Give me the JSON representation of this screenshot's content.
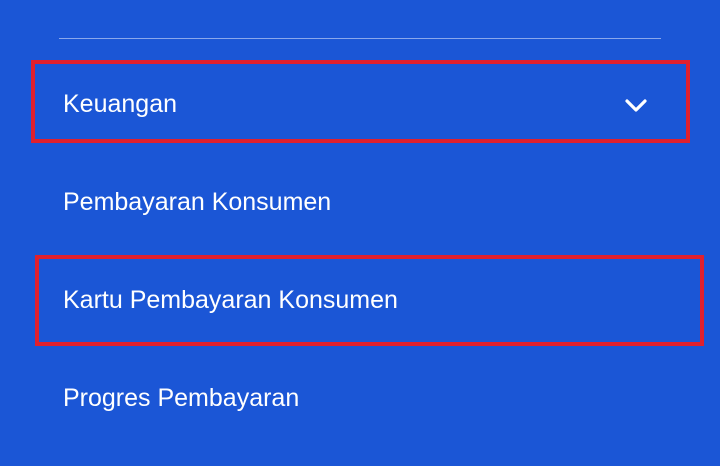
{
  "menu": {
    "items": [
      {
        "label": "Keuangan",
        "expanded": true,
        "icon": "chevron-down-icon"
      },
      {
        "label": "Pembayaran Konsumen"
      },
      {
        "label": "Kartu Pembayaran Konsumen"
      },
      {
        "label": "Progres Pembayaran"
      }
    ]
  },
  "colors": {
    "background": "#1b56d6",
    "text": "#ffffff",
    "divider": "#8aa8ec",
    "highlight": "#e0202e"
  }
}
